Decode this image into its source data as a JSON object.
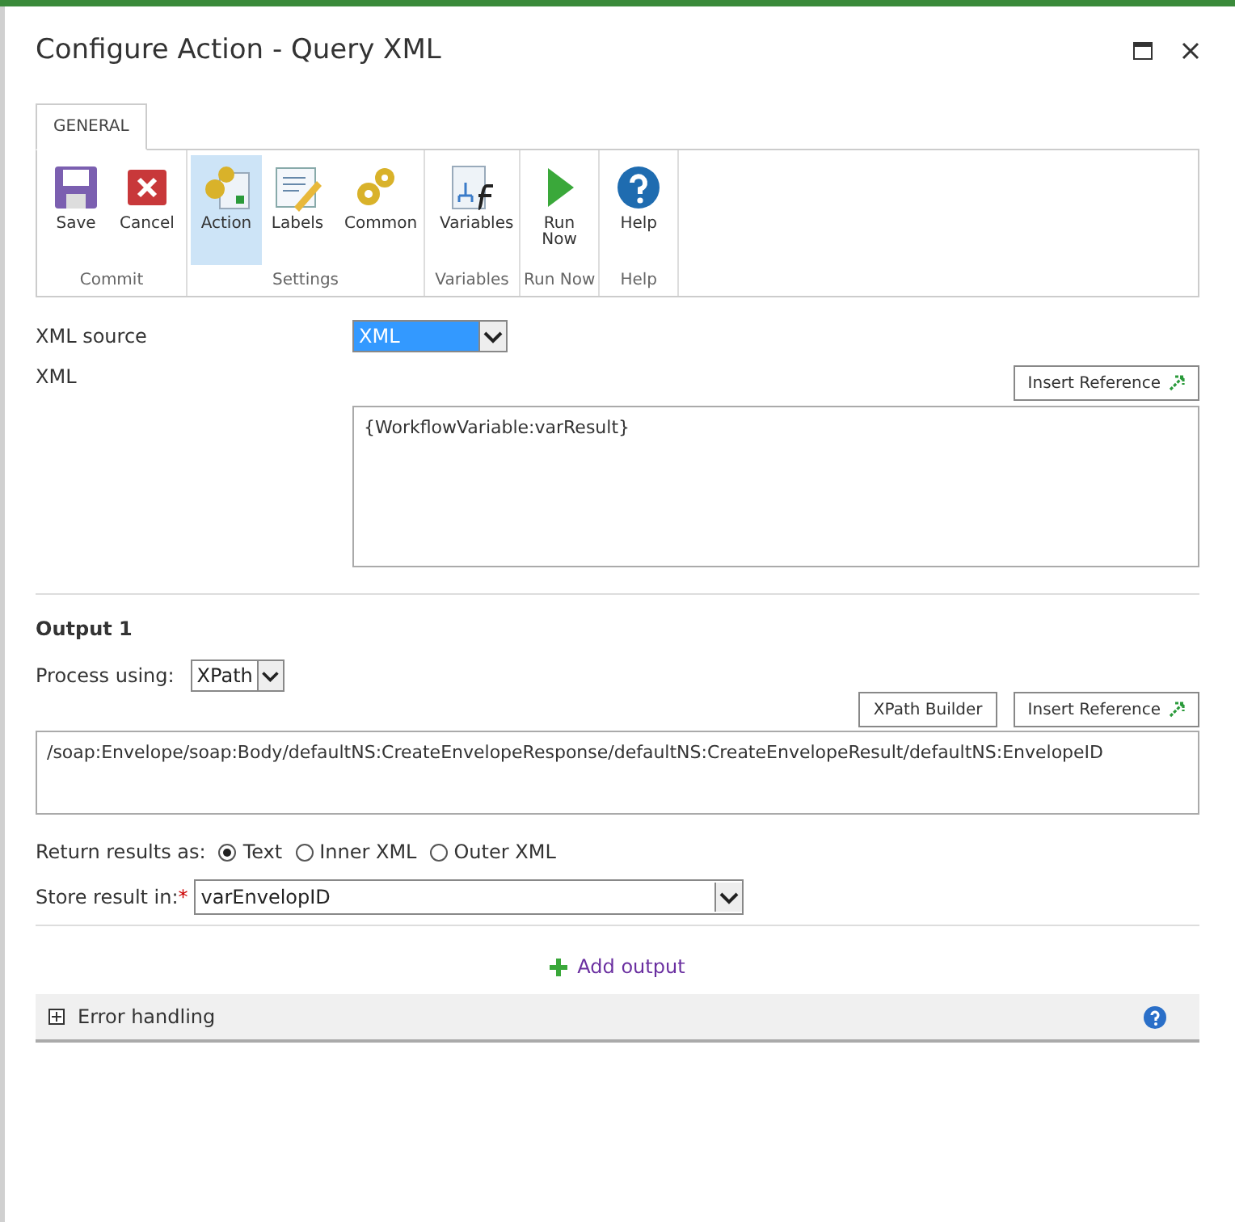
{
  "window": {
    "title": "Configure Action - Query XML"
  },
  "tabs": [
    {
      "label": "GENERAL",
      "selected": true
    }
  ],
  "ribbon": {
    "groups": [
      {
        "label": "Commit",
        "buttons": [
          {
            "label": "Save",
            "kind": "save",
            "selected": false
          },
          {
            "label": "Cancel",
            "kind": "cancel",
            "selected": false
          }
        ]
      },
      {
        "label": "Settings",
        "buttons": [
          {
            "label": "Action",
            "kind": "action",
            "selected": true
          },
          {
            "label": "Labels",
            "kind": "labels",
            "selected": false
          },
          {
            "label": "Common",
            "kind": "common",
            "selected": false
          }
        ]
      },
      {
        "label": "Variables",
        "buttons": [
          {
            "label": "Variables",
            "kind": "variables",
            "selected": false
          }
        ]
      },
      {
        "label": "Run Now",
        "buttons": [
          {
            "label": "Run Now",
            "kind": "run",
            "selected": false
          }
        ]
      },
      {
        "label": "Help",
        "buttons": [
          {
            "label": "Help",
            "kind": "help",
            "selected": false
          }
        ]
      }
    ]
  },
  "xml_source": {
    "label": "XML source",
    "value": "XML"
  },
  "xml": {
    "label": "XML",
    "insert_button": "Insert Reference",
    "value": "{WorkflowVariable:varResult}"
  },
  "output": {
    "title": "Output 1",
    "process_label": "Process using:",
    "process_value": "XPath",
    "xpath_button": "XPath Builder",
    "insert_button": "Insert Reference",
    "value": "/soap:Envelope/soap:Body/defaultNS:CreateEnvelopeResponse/defaultNS:CreateEnvelopeResult/defaultNS:EnvelopeID",
    "return_label": "Return results as:",
    "return_options": [
      {
        "label": "Text",
        "selected": true
      },
      {
        "label": "Inner XML",
        "selected": false
      },
      {
        "label": "Outer XML",
        "selected": false
      }
    ],
    "store_label": "Store result in:",
    "required_mark": "*",
    "store_value": "varEnvelopID"
  },
  "add_output": "Add output",
  "error_handling": {
    "label": "Error handling",
    "expanded": false
  }
}
